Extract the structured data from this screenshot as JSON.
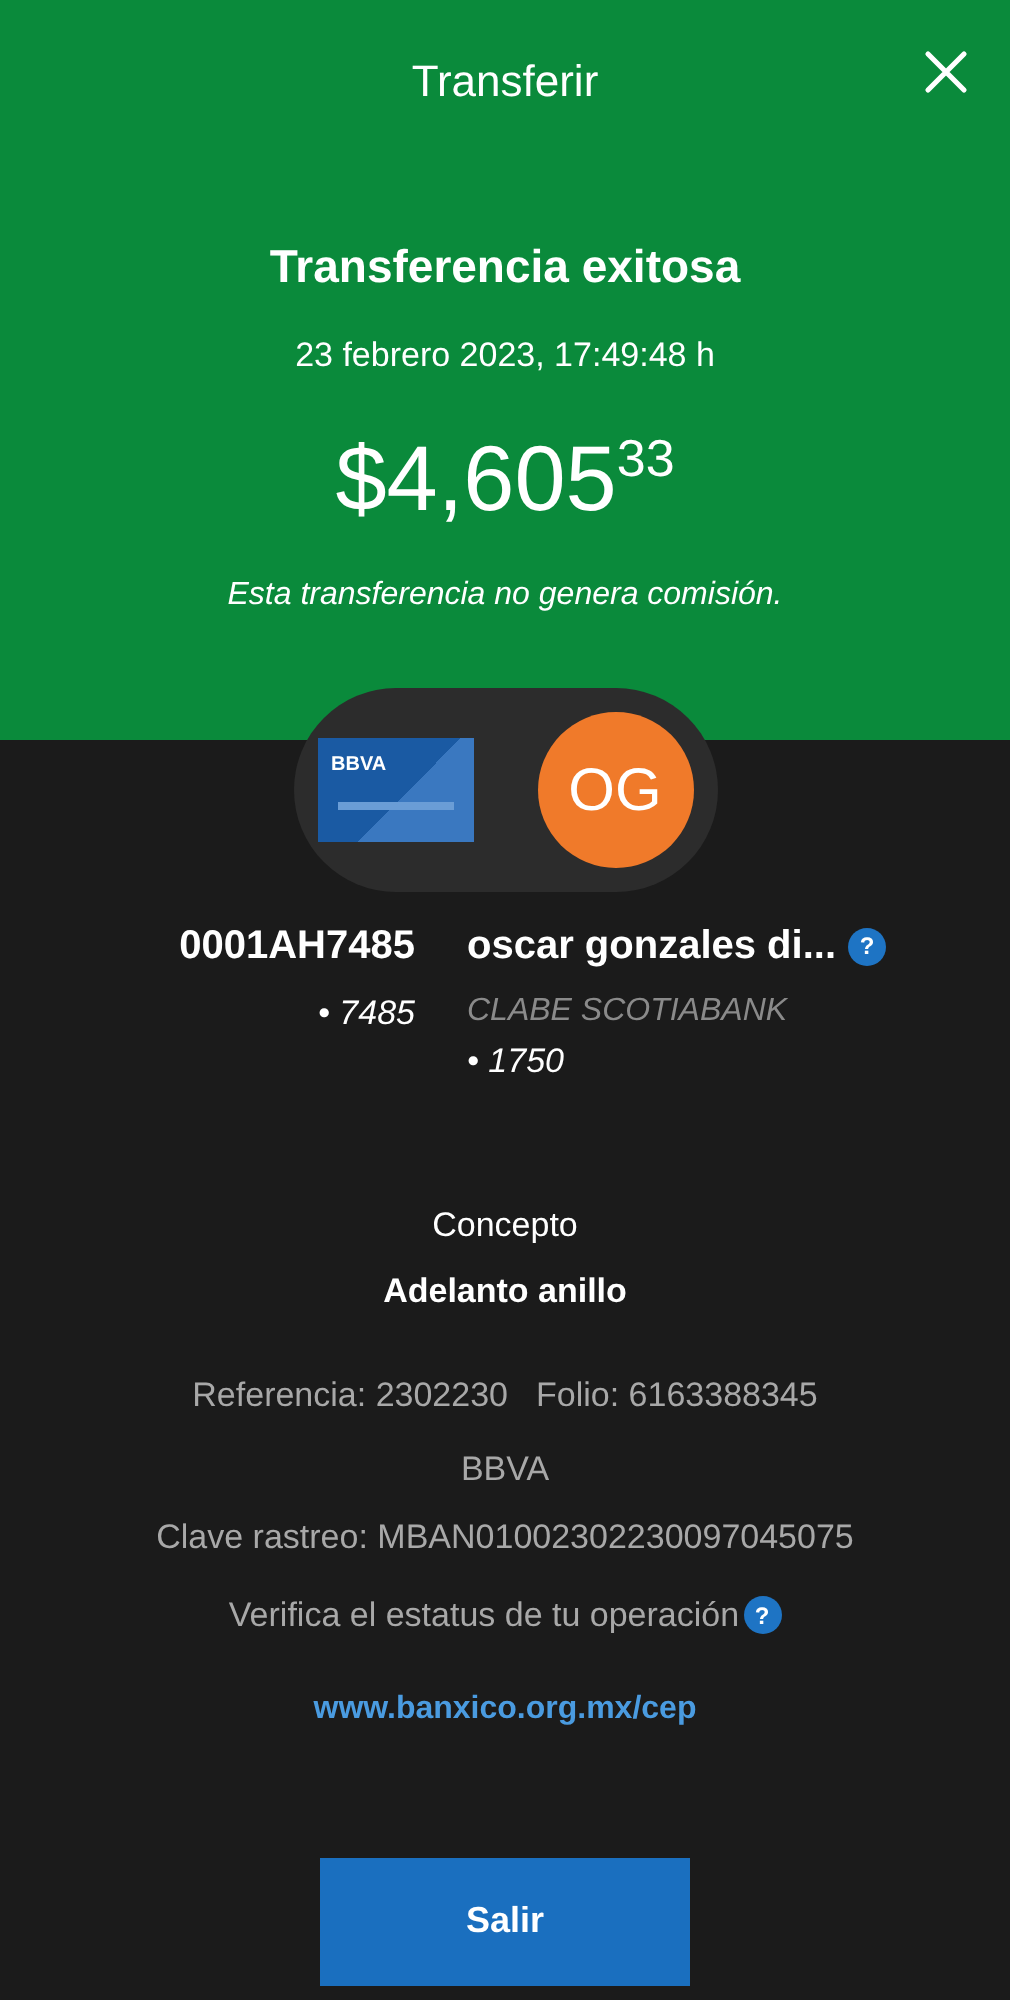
{
  "header": {
    "title": "Transferir"
  },
  "result": {
    "title": "Transferencia exitosa",
    "datetime": "23 febrero 2023, 17:49:48 h",
    "amount_main": "$4,605",
    "amount_cents": "33",
    "note": "Esta transferencia no genera comisión."
  },
  "origin": {
    "card_brand": "BBVA",
    "account": "0001AH7485",
    "suffix": "• 7485"
  },
  "destination": {
    "initials": "OG",
    "help_icon": "?",
    "name": "oscar gonzales di...",
    "bank": "CLABE SCOTIABANK",
    "suffix": "• 1750"
  },
  "concept": {
    "label": "Concepto",
    "value": "Adelanto anillo"
  },
  "details": {
    "reference": "Referencia: 2302230",
    "folio": "Folio: 6163388345",
    "bank": "BBVA",
    "tracking": "Clave rastreo: MBAN01002302230097045075",
    "verify": "Verifica el estatus de tu operación",
    "help_icon": "?",
    "link": "www.banxico.org.mx/cep"
  },
  "button": "Salir"
}
